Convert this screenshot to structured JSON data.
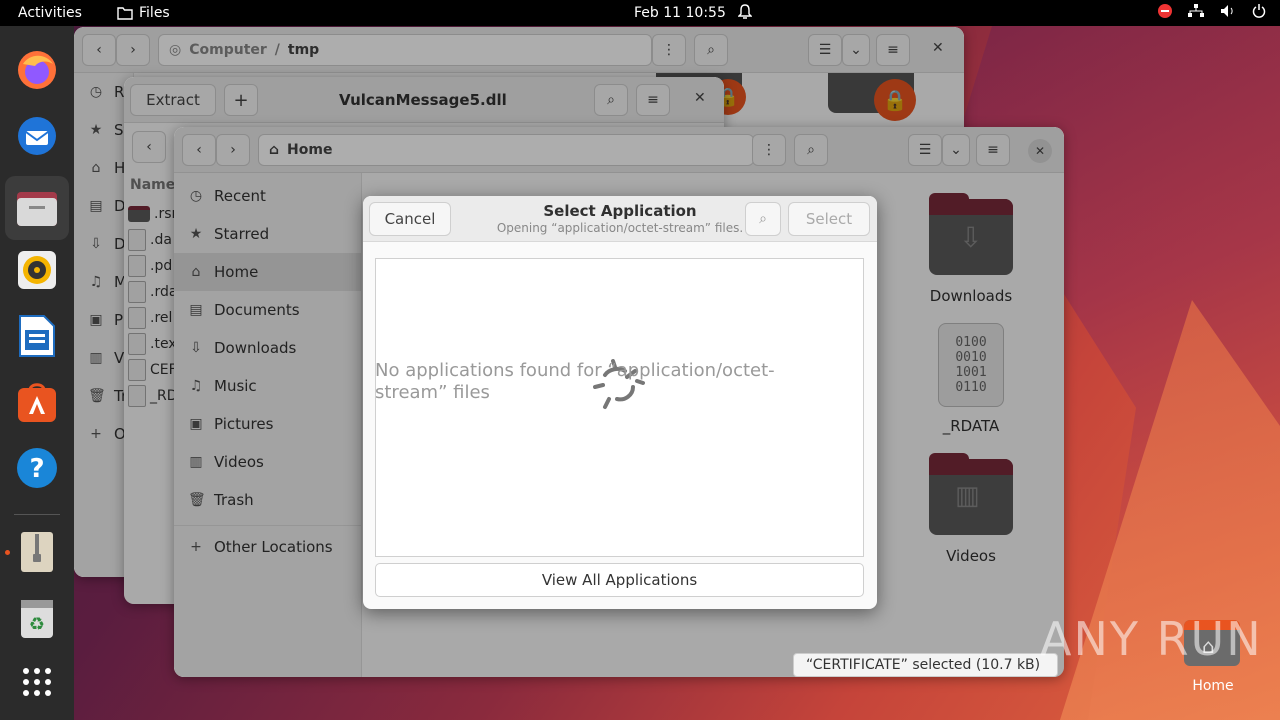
{
  "topbar": {
    "activities": "Activities",
    "app_name": "Files",
    "clock": "Feb 11  10:55"
  },
  "win_tmp": {
    "path_parent": "Computer",
    "path_sep": "/",
    "path_current": "tmp",
    "sidebar_partial": [
      "Re",
      "St",
      "H",
      "D",
      "D",
      "M",
      "Pi",
      "Vi",
      "Tr",
      "O"
    ]
  },
  "win_archive": {
    "extract_label": "Extract",
    "title": "VulcanMessage5.dll",
    "column_header": "Name",
    "files": [
      ".rsr",
      ".da",
      ".pd",
      ".rda",
      ".rel",
      ".tex",
      "CEF",
      "_RD"
    ]
  },
  "win_home": {
    "path": "Home",
    "sidebar": [
      {
        "label": "Recent",
        "icon": "clock-icon"
      },
      {
        "label": "Starred",
        "icon": "star-icon"
      },
      {
        "label": "Home",
        "icon": "home-icon",
        "selected": true
      },
      {
        "label": "Documents",
        "icon": "document-icon"
      },
      {
        "label": "Downloads",
        "icon": "download-icon"
      },
      {
        "label": "Music",
        "icon": "music-icon"
      },
      {
        "label": "Pictures",
        "icon": "picture-icon"
      },
      {
        "label": "Videos",
        "icon": "video-icon"
      },
      {
        "label": "Trash",
        "icon": "trash-icon"
      }
    ],
    "other_locations": "Other Locations",
    "items": {
      "downloads": "Downloads",
      "rdata": "_RDATA",
      "videos": "Videos"
    },
    "binary_glyph": [
      "0100",
      "0010",
      "1001",
      "0110"
    ],
    "status": "“CERTIFICATE” selected  (10.7 kB)"
  },
  "dialog": {
    "cancel": "Cancel",
    "title": "Select Application",
    "subtitle": "Opening “application/octet-stream” files.",
    "select": "Select",
    "empty_message": "No applications found for “application/octet-stream” files",
    "view_all": "View All Applications"
  },
  "desktop": {
    "home_label": "Home"
  },
  "watermark": "ANY RUN"
}
